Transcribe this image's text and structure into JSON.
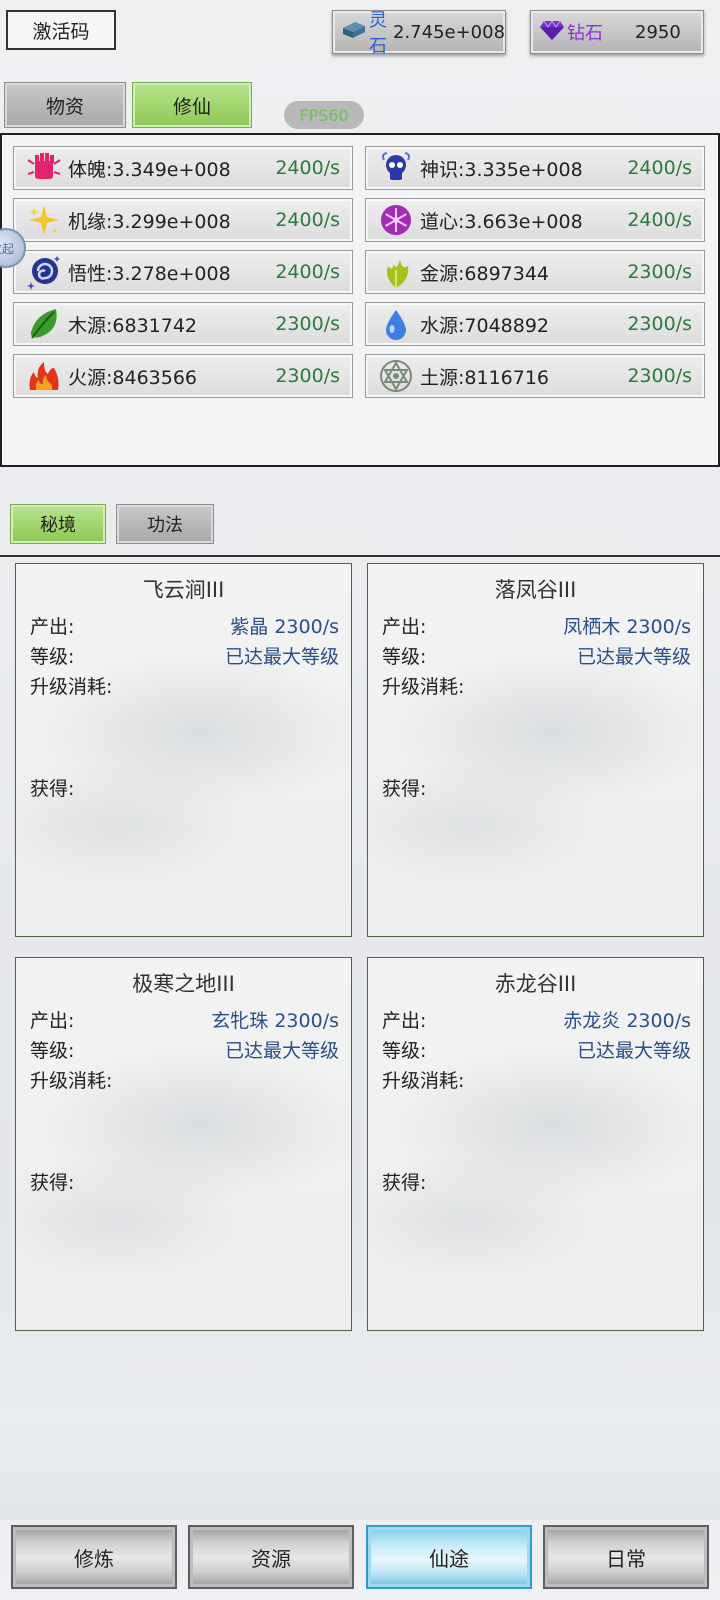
{
  "header": {
    "code_button": "激活码",
    "spirit_stone": {
      "label": "灵石",
      "value": "2.745e+008",
      "icon": "spirit-stone-icon"
    },
    "diamond": {
      "label": "钻石",
      "value": "2950",
      "icon": "diamond-icon"
    }
  },
  "top_tabs": [
    {
      "label": "物资",
      "active": false
    },
    {
      "label": "修仙",
      "active": true
    }
  ],
  "fps": "FPS60",
  "stats": [
    {
      "label": "体魄:3.349e+008",
      "rate": "2400/s",
      "icon": "fist-icon",
      "color": "#e2246e"
    },
    {
      "label": "神识:3.335e+008",
      "rate": "2400/s",
      "icon": "skull-icon",
      "color": "#2a3aa8"
    },
    {
      "label": "机缘:3.299e+008",
      "rate": "2400/s",
      "icon": "sparkle-icon",
      "color": "#e8b820"
    },
    {
      "label": "道心:3.663e+008",
      "rate": "2400/s",
      "icon": "snowflake-icon",
      "color": "#a22bb5"
    },
    {
      "label": "悟性:3.278e+008",
      "rate": "2400/s",
      "icon": "swirl-icon",
      "color": "#24348f"
    },
    {
      "label": "金源:6897344",
      "rate": "2300/s",
      "icon": "gold-leaf-icon",
      "color": "#a4c21a"
    },
    {
      "label": "木源:6831742",
      "rate": "2300/s",
      "icon": "leaf-icon",
      "color": "#3a9a2a"
    },
    {
      "label": "水源:7048892",
      "rate": "2300/s",
      "icon": "water-drop-icon",
      "color": "#3f7fe0"
    },
    {
      "label": "火源:8463566",
      "rate": "2300/s",
      "icon": "fire-icon",
      "color": "#e2331b"
    },
    {
      "label": "土源:8116716",
      "rate": "2300/s",
      "icon": "hexagram-icon",
      "color": "#7a8a78"
    }
  ],
  "side_handle": "收起",
  "sub_tabs": [
    {
      "label": "秘境",
      "active": true
    },
    {
      "label": "功法",
      "active": false
    }
  ],
  "cards": [
    {
      "title": "飞云涧III",
      "output_key": "产出:",
      "output_val": "紫晶 2300/s",
      "level_key": "等级:",
      "level_val": "已达最大等级",
      "cost_key": "升级消耗:",
      "gain_key": "获得:"
    },
    {
      "title": "落凤谷III",
      "output_key": "产出:",
      "output_val": "凤栖木 2300/s",
      "level_key": "等级:",
      "level_val": "已达最大等级",
      "cost_key": "升级消耗:",
      "gain_key": "获得:"
    },
    {
      "title": "极寒之地III",
      "output_key": "产出:",
      "output_val": "玄牝珠 2300/s",
      "level_key": "等级:",
      "level_val": "已达最大等级",
      "cost_key": "升级消耗:",
      "gain_key": "获得:"
    },
    {
      "title": "赤龙谷III",
      "output_key": "产出:",
      "output_val": "赤龙炎 2300/s",
      "level_key": "等级:",
      "level_val": "已达最大等级",
      "cost_key": "升级消耗:",
      "gain_key": "获得:"
    }
  ],
  "bottom_nav": [
    {
      "label": "修炼",
      "active": false
    },
    {
      "label": "资源",
      "active": false
    },
    {
      "label": "仙途",
      "active": true
    },
    {
      "label": "日常",
      "active": false
    }
  ]
}
